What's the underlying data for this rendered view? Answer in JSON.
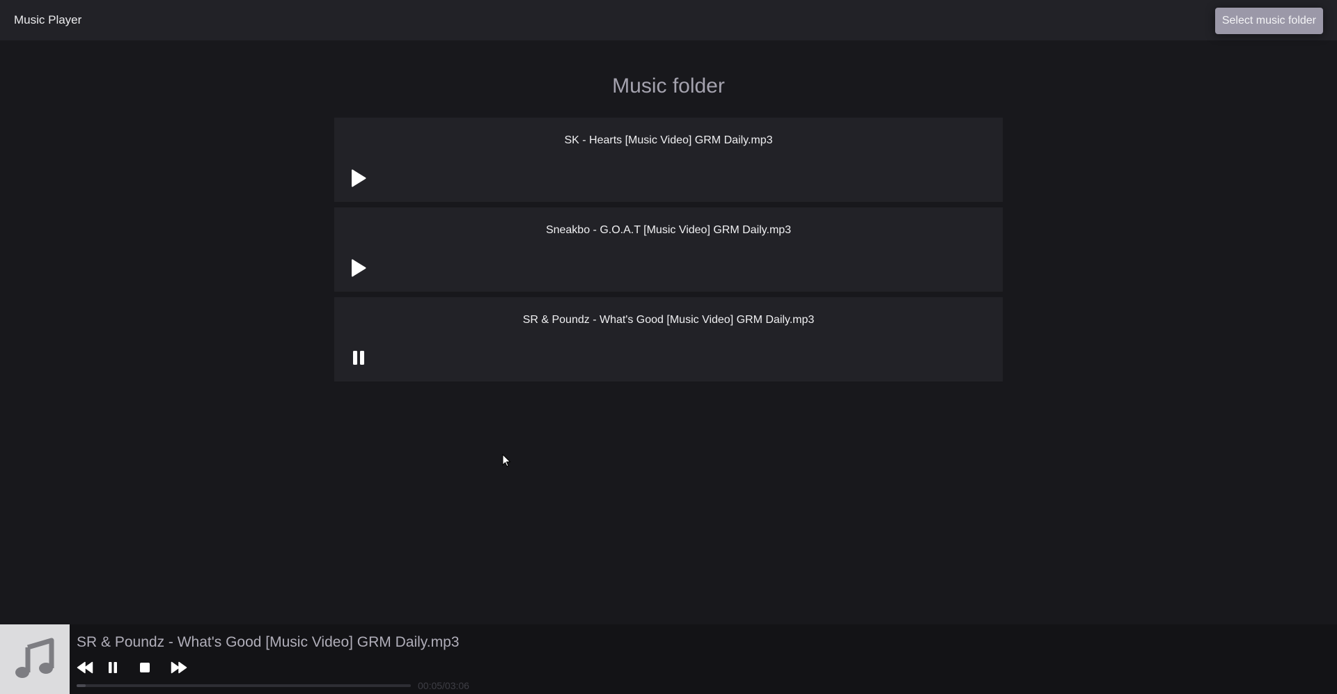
{
  "header": {
    "app_title": "Music Player",
    "select_folder_label": "Select music folder"
  },
  "main": {
    "heading": "Music folder",
    "tracks": [
      {
        "title": "SK - Hearts [Music Video] GRM Daily.mp3",
        "state": "play"
      },
      {
        "title": "Sneakbo - G.O.A.T [Music Video] GRM Daily.mp3",
        "state": "play"
      },
      {
        "title": "SR & Poundz - What's Good [Music Video] GRM Daily.mp3",
        "state": "pause"
      }
    ]
  },
  "player": {
    "now_playing": "SR & Poundz - What's Good [Music Video] GRM Daily.mp3",
    "time_display": "00:05/03:06",
    "progress_fraction": 0.027,
    "art_icon": "music-note-icon",
    "controls": [
      "rewind-icon",
      "pause-icon",
      "stop-icon",
      "fast-forward-icon"
    ]
  },
  "colors": {
    "background": "#18181c",
    "panel": "#222227",
    "accent_button": "#9b98a8"
  }
}
